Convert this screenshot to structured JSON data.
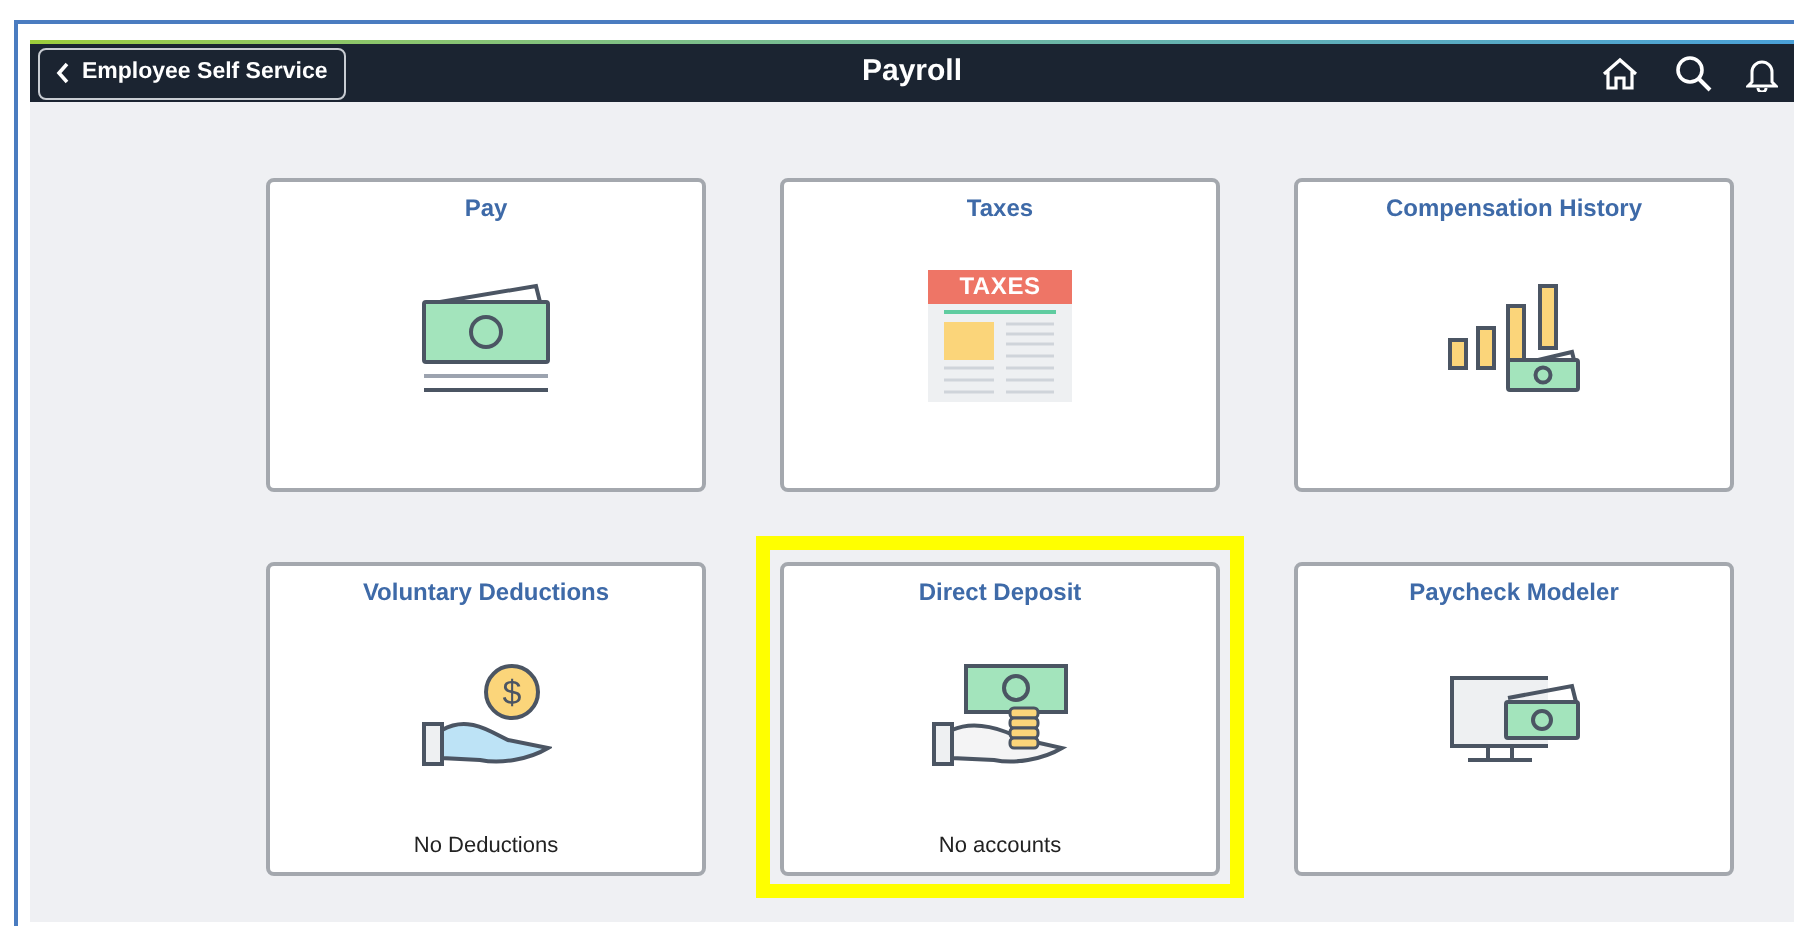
{
  "header": {
    "back_button": "Employee Self Service",
    "title": "Payroll"
  },
  "tiles": [
    {
      "title": "Pay",
      "kind": "cash",
      "highlighted": false
    },
    {
      "title": "Taxes",
      "kind": "taxes",
      "icon_text": "TAXES",
      "highlighted": false
    },
    {
      "title": "Compensation History",
      "kind": "growth",
      "highlighted": false
    },
    {
      "title": "Voluntary Deductions",
      "kind": "coin-hand",
      "icon_text": "$",
      "footer": "No Deductions",
      "highlighted": false
    },
    {
      "title": "Direct Deposit",
      "kind": "deposit",
      "footer": "No accounts",
      "highlighted": true
    },
    {
      "title": "Paycheck Modeler",
      "kind": "monitor",
      "highlighted": false
    }
  ]
}
